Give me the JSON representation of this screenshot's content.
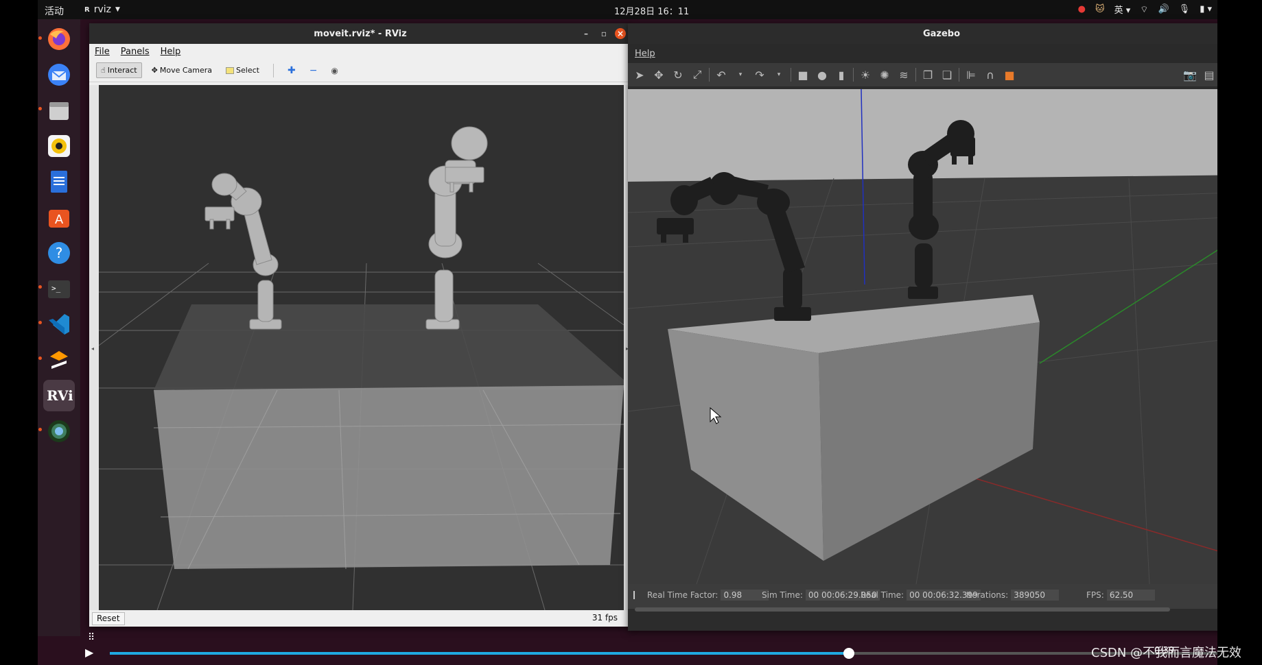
{
  "topbar": {
    "activities": "活动",
    "app_menu": "rviz",
    "clock": "12月28日  16：11",
    "input_method": "英"
  },
  "dock": {
    "items": [
      "firefox-icon",
      "thunderbird-icon",
      "files-icon",
      "rhythmbox-icon",
      "writer-icon",
      "software-icon",
      "help-icon",
      "terminal-icon",
      "vscode-icon",
      "sublime-icon",
      "rviz-icon",
      "gazebo-icon"
    ]
  },
  "rviz": {
    "title": "moveit.rviz* - RViz",
    "menu": [
      "File",
      "Panels",
      "Help"
    ],
    "tools": {
      "interact": "Interact",
      "move_camera": "Move Camera",
      "select": "Select"
    },
    "reset_label": "Reset",
    "fps": "31 fps"
  },
  "gazebo": {
    "title": "Gazebo",
    "menu": [
      "Help"
    ],
    "status": {
      "rtf_label": "Real Time Factor:",
      "rtf_value": "0.98",
      "sim_time_label": "Sim Time:",
      "sim_time_value": "00 00:06:29.050",
      "real_time_label": "Real Time:",
      "real_time_value": "00 00:06:32.399",
      "iterations_label": "Iterations:",
      "iterations_value": "389050",
      "fps_label": "FPS:",
      "fps_value": "62.50"
    }
  },
  "player": {
    "progress": 0.665,
    "time": "0:39"
  },
  "watermark": "CSDN @不我而言魔法无效",
  "colors": {
    "ubuntu_orange": "#e95420",
    "progress_blue": "#1fa9e1"
  }
}
